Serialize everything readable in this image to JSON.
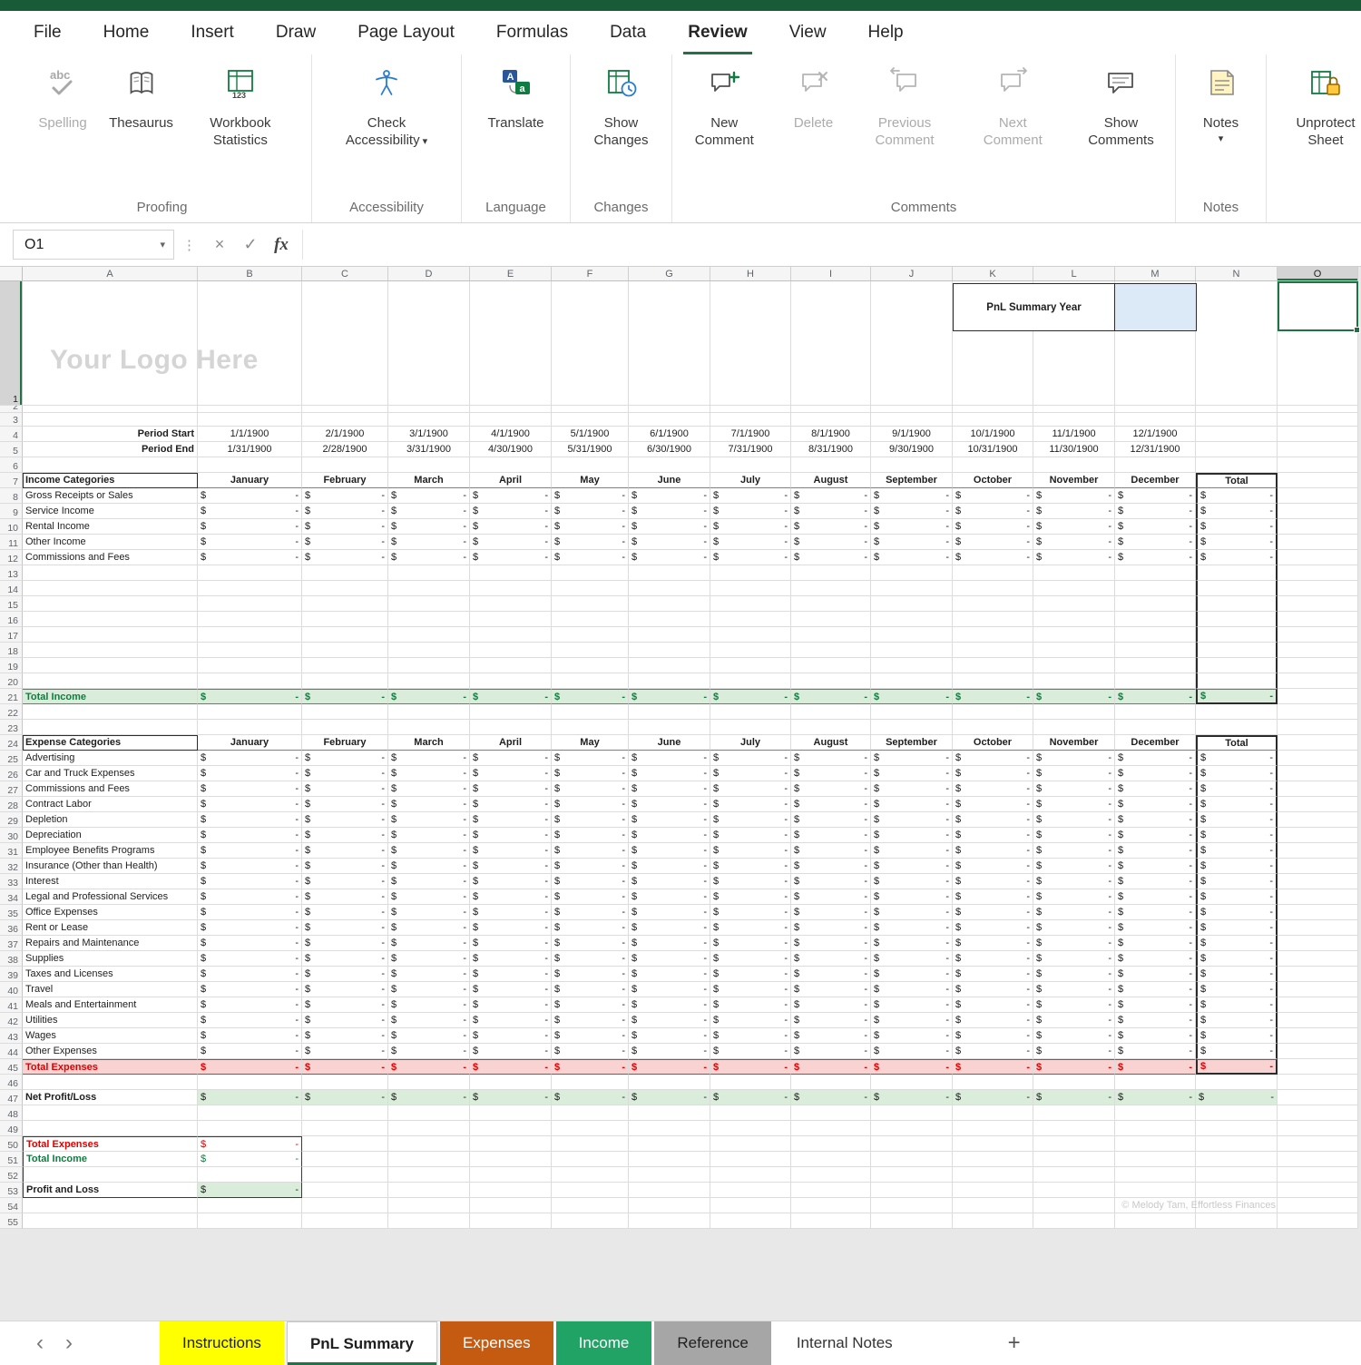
{
  "menubar": {
    "tabs": [
      "File",
      "Home",
      "Insert",
      "Draw",
      "Page Layout",
      "Formulas",
      "Data",
      "Review",
      "View",
      "Help"
    ],
    "active_tab": "Review"
  },
  "ribbon": {
    "groups": [
      {
        "label": "Proofing",
        "buttons": [
          {
            "label": "Spelling",
            "enabled": false
          },
          {
            "label": "Thesaurus",
            "enabled": true
          },
          {
            "label": "Workbook Statistics",
            "enabled": true
          }
        ]
      },
      {
        "label": "Accessibility",
        "buttons": [
          {
            "label": "Check Accessibility",
            "enabled": true,
            "dropdown": true
          }
        ]
      },
      {
        "label": "Language",
        "buttons": [
          {
            "label": "Translate",
            "enabled": true
          }
        ]
      },
      {
        "label": "Changes",
        "buttons": [
          {
            "label": "Show Changes",
            "enabled": true
          }
        ]
      },
      {
        "label": "Comments",
        "buttons": [
          {
            "label": "New Comment",
            "enabled": true
          },
          {
            "label": "Delete",
            "enabled": false
          },
          {
            "label": "Previous Comment",
            "enabled": false
          },
          {
            "label": "Next Comment",
            "enabled": false
          },
          {
            "label": "Show Comments",
            "enabled": true
          }
        ]
      },
      {
        "label": "Notes",
        "buttons": [
          {
            "label": "Notes",
            "enabled": true,
            "dropdown": true
          }
        ]
      },
      {
        "label": "",
        "buttons": [
          {
            "label": "Unprotect Sheet",
            "enabled": true
          }
        ]
      }
    ]
  },
  "formula_bar": {
    "name_box": "O1",
    "formula": ""
  },
  "icons": {
    "chevron_down": "▾",
    "dots": "⋮",
    "cancel": "×",
    "enter": "✓",
    "fx": "fx",
    "nav_prev": "‹",
    "nav_next": "›",
    "add_sheet": "+"
  },
  "grid": {
    "columns": [
      "A",
      "B",
      "C",
      "D",
      "E",
      "F",
      "G",
      "H",
      "I",
      "J",
      "K",
      "L",
      "M",
      "N",
      "O"
    ],
    "row_count": 55,
    "selected_cell": "O1",
    "logo_text": "Your Logo Here",
    "pnl_summary_year_label": "PnL Summary Year",
    "period_start_label": "Period Start",
    "period_end_label": "Period End",
    "period_start_dates": [
      "1/1/1900",
      "2/1/1900",
      "3/1/1900",
      "4/1/1900",
      "5/1/1900",
      "6/1/1900",
      "7/1/1900",
      "8/1/1900",
      "9/1/1900",
      "10/1/1900",
      "11/1/1900",
      "12/1/1900"
    ],
    "period_end_dates": [
      "1/31/1900",
      "2/28/1900",
      "3/31/1900",
      "4/30/1900",
      "5/31/1900",
      "6/30/1900",
      "7/31/1900",
      "8/31/1900",
      "9/30/1900",
      "10/31/1900",
      "11/30/1900",
      "12/31/1900"
    ],
    "months": [
      "January",
      "February",
      "March",
      "April",
      "May",
      "June",
      "July",
      "August",
      "September",
      "October",
      "November",
      "December"
    ],
    "total_column_label": "Total",
    "money_dollar": "$",
    "money_value": "-",
    "income": {
      "header": "Income Categories",
      "categories": [
        "Gross Receipts or Sales",
        "Service Income",
        "Rental Income",
        "Other Income",
        "Commissions and Fees"
      ],
      "total_label": "Total Income"
    },
    "expenses": {
      "header": "Expense Categories",
      "categories": [
        "Advertising",
        "Car and Truck Expenses",
        "Commissions and Fees",
        "Contract Labor",
        "Depletion",
        "Depreciation",
        "Employee Benefits Programs",
        "Insurance (Other than Health)",
        "Interest",
        "Legal and Professional Services",
        "Office Expenses",
        "Rent or Lease",
        "Repairs and Maintenance",
        "Supplies",
        "Taxes and Licenses",
        "Travel",
        "Meals and Entertainment",
        "Utilities",
        "Wages",
        "Other Expenses"
      ],
      "total_label": "Total Expenses"
    },
    "net_profit_label": "Net Profit/Loss",
    "summary_block": {
      "total_expenses": "Total Expenses",
      "total_income": "Total Income",
      "profit_and_loss": "Profit and Loss"
    },
    "copyright": "© Melody Tam, Effortless Finances"
  },
  "sheet_tabs": {
    "tabs": [
      {
        "label": "Instructions",
        "color": "#FFFF00",
        "text_color": "#1F1F1F",
        "active": false
      },
      {
        "label": "PnL Summary",
        "color": "#FFFFFF",
        "text_color": "#1E1E1E",
        "active": true
      },
      {
        "label": "Expenses",
        "color": "#C55A11",
        "text_color": "#FFFFFF",
        "active": false
      },
      {
        "label": "Income",
        "color": "#21A366",
        "text_color": "#FFFFFF",
        "active": false
      },
      {
        "label": "Reference",
        "color": "#A6A6A6",
        "text_color": "#1F1F1F",
        "active": false
      },
      {
        "label": "Internal Notes",
        "color": "",
        "text_color": "#333333",
        "active": false
      }
    ]
  }
}
